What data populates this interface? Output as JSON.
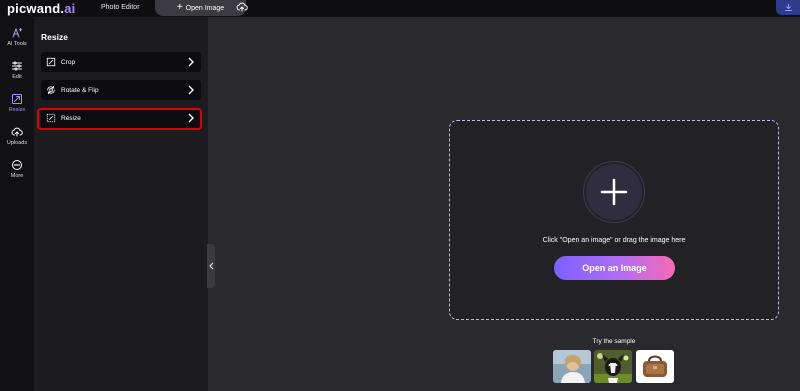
{
  "topbar": {
    "logo_main": "picwand.",
    "logo_ai": "ai",
    "title": "Photo Editor",
    "open_image_label": "Open Image",
    "cloud_icon": "cloud-upload-icon",
    "download_icon": "download-icon"
  },
  "rail": {
    "items": [
      {
        "label": "AI Tools",
        "icon": "ai-tools-icon"
      },
      {
        "label": "Edit",
        "icon": "sliders-icon"
      },
      {
        "label": "Resize",
        "icon": "resize-icon",
        "active": true
      },
      {
        "label": "Uploads",
        "icon": "cloud-upload-icon"
      },
      {
        "label": "More",
        "icon": "more-icon"
      }
    ]
  },
  "panel": {
    "title": "Resize",
    "items": [
      {
        "label": "Crop",
        "icon": "crop-icon"
      },
      {
        "label": "Rotate & Flip",
        "icon": "rotate-icon"
      },
      {
        "label": "Resize",
        "icon": "resize-icon",
        "highlighted": true
      }
    ]
  },
  "dropzone": {
    "instruction": "Click \"Open an image\" or drag the image here",
    "button_label": "Open an Image"
  },
  "samples": {
    "label": "Try the sample",
    "items": [
      "sample-woman",
      "sample-dog",
      "sample-bag"
    ]
  },
  "colors": {
    "accent": "#a78bfa",
    "highlight": "#e00000",
    "button_gradient_start": "#7b61ff",
    "button_gradient_end": "#f76bb3"
  }
}
